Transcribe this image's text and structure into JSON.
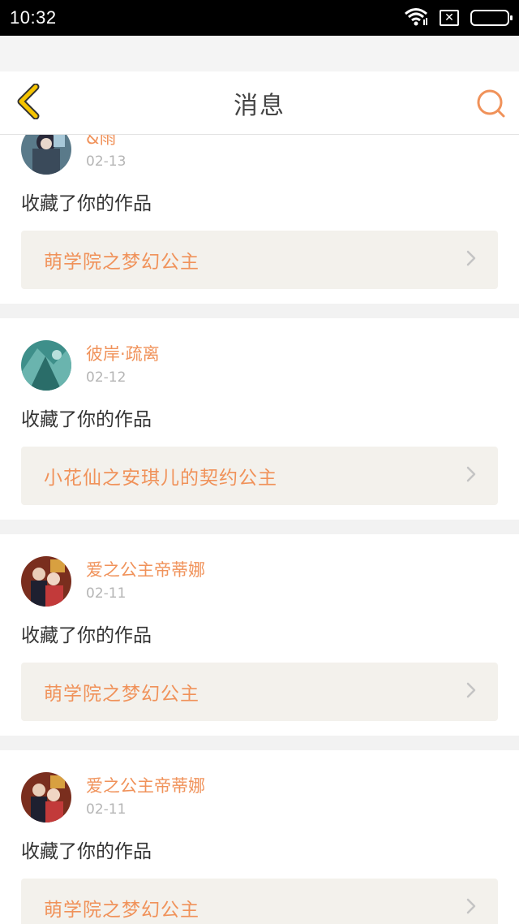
{
  "status_bar": {
    "time": "10:32",
    "icons": [
      "wifi-icon",
      "sim-off-icon",
      "battery-icon"
    ]
  },
  "header": {
    "title": "消息",
    "back_icon": "chevron-left-icon",
    "search_icon": "search-icon"
  },
  "colors": {
    "accent": "#f0925a",
    "back_icon": "#f5c400",
    "text_primary": "#333333",
    "text_muted": "#b5b5b5",
    "work_bg": "#f3f1ec",
    "page_bg": "#f2f2f2"
  },
  "messages": [
    {
      "username": "&雨",
      "date": "02-13",
      "action": "收藏了你的作品",
      "work_title": "萌学院之梦幻公主"
    },
    {
      "username": "彼岸·疏离",
      "date": "02-12",
      "action": "收藏了你的作品",
      "work_title": "小花仙之安琪儿的契约公主"
    },
    {
      "username": "爱之公主帝蒂娜",
      "date": "02-11",
      "action": "收藏了你的作品",
      "work_title": "萌学院之梦幻公主"
    },
    {
      "username": "爱之公主帝蒂娜",
      "date": "02-11",
      "action": "收藏了你的作品",
      "work_title": "萌学院之梦幻公主"
    }
  ]
}
